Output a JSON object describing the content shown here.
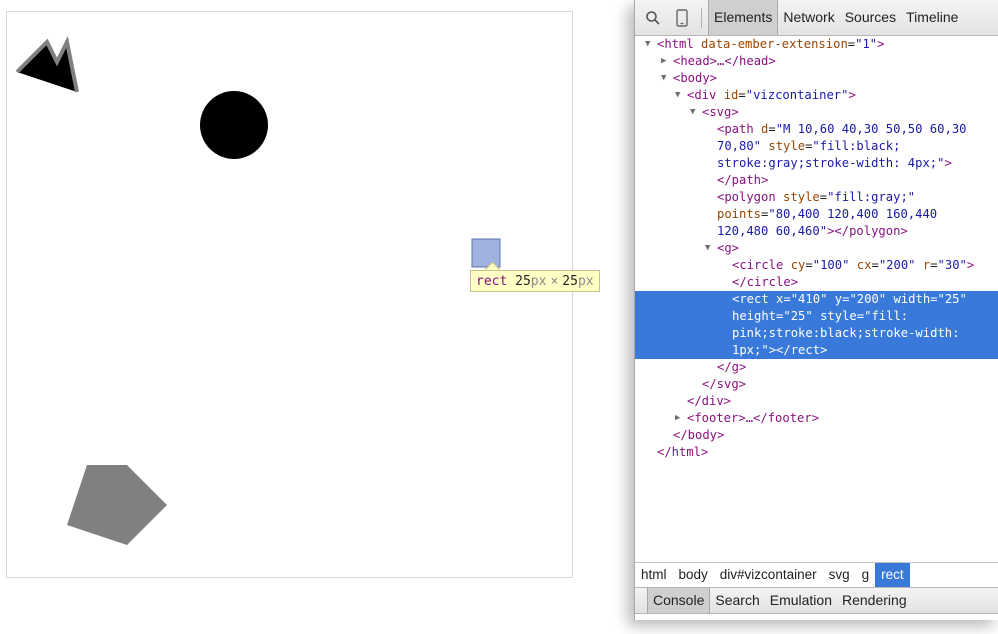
{
  "viewport": {
    "shapes": {
      "path_fill": "#000000",
      "path_stroke": "#808080",
      "circle_fill": "#000000",
      "polygon_fill": "#808080",
      "rect_highlight": "#9fb1dc"
    },
    "tooltip": {
      "tag": "rect",
      "width": "25",
      "height": "25",
      "unit": "px",
      "times": "×"
    }
  },
  "devtools": {
    "toolbar": {
      "search_icon": "magnifier-icon",
      "device_icon": "device-mode-icon",
      "tabs": [
        "Elements",
        "Network",
        "Sources",
        "Timeline"
      ],
      "active_tab": "Elements"
    },
    "dom": {
      "html_open_tag": "<html",
      "html_attr_name": "data-ember-extension",
      "html_attr_value": "\"1\"",
      "head": "<head>…</head>",
      "body_open": "<body>",
      "div_open_tag": "<div",
      "div_attr_name": "id",
      "div_attr_value": "\"vizcontainer\"",
      "svg_open": "<svg>",
      "path_tag": "<path",
      "path_d_name": "d",
      "path_d_value": "\"M 10,60 40,30 50,50 60,30 70,80\"",
      "path_style_name": "style",
      "path_style_value": "\"fill:black; stroke:gray;stroke-width: 4px;\"",
      "path_close": "></path>",
      "polygon_tag": "<polygon",
      "polygon_style_name": "style",
      "polygon_style_value": "\"fill:gray;\"",
      "polygon_points_name": "points",
      "polygon_points_value": "\"80,400 120,400 160,440 120,480 60,460\"",
      "polygon_close": "></polygon>",
      "g_open": "<g>",
      "circle_tag": "<circle",
      "circle_cy_name": "cy",
      "circle_cy_value": "\"100\"",
      "circle_cx_name": "cx",
      "circle_cx_value": "\"200\"",
      "circle_r_name": "r",
      "circle_r_value": "\"30\"",
      "circle_close": "></circle>",
      "rect_tag": "<rect",
      "rect_x_name": "x",
      "rect_x_value": "\"410\"",
      "rect_y_name": "y",
      "rect_y_value": "\"200\"",
      "rect_w_name": "width",
      "rect_w_value": "\"25\"",
      "rect_h_name": "height",
      "rect_h_value": "\"25\"",
      "rect_style_name": "style",
      "rect_style_value": "\"fill: pink;stroke:black;stroke-width: 1px;\"",
      "rect_close": "></rect>",
      "g_close": "</g>",
      "svg_close": "</svg>",
      "div_close": "</div>",
      "footer": "<footer>…</footer>",
      "body_close": "</body>",
      "html_close": "</html>",
      "eq": "=",
      "selected_color": "#3879d9"
    },
    "breadcrumbs": [
      "html",
      "body",
      "div#vizcontainer",
      "svg",
      "g",
      "rect"
    ],
    "drawer_tabs": [
      "Console",
      "Search",
      "Emulation",
      "Rendering"
    ]
  }
}
